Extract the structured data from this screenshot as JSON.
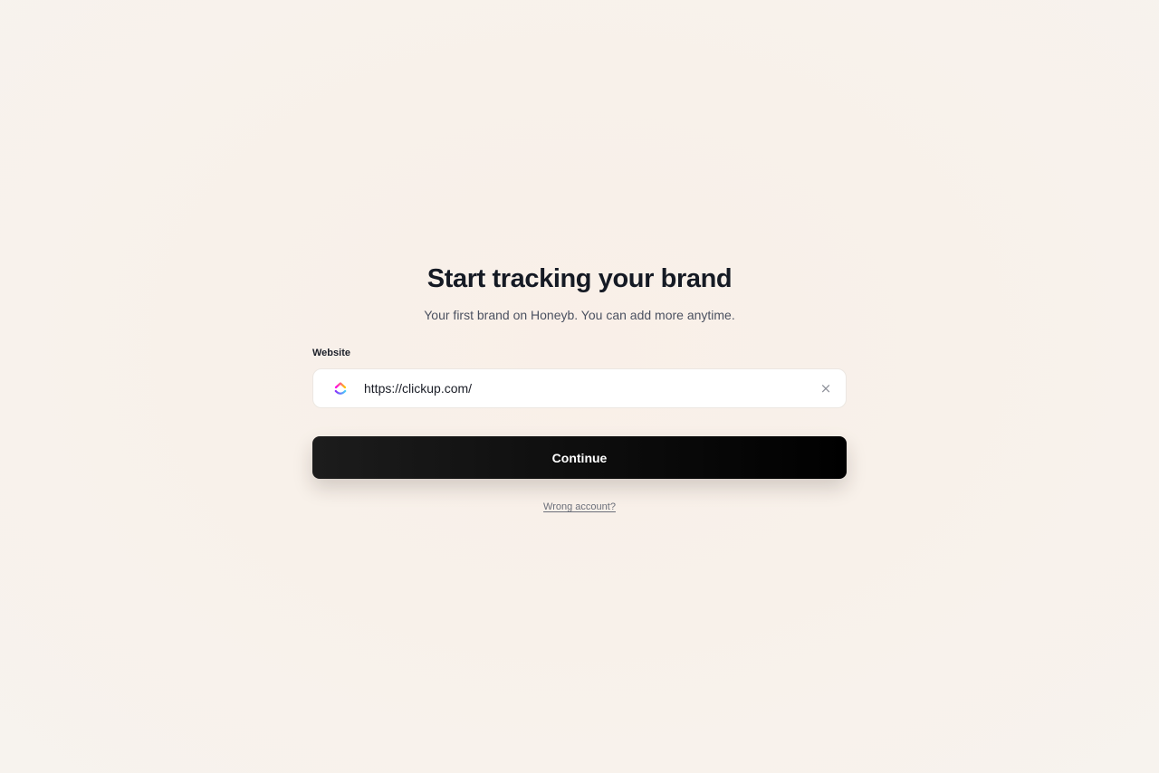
{
  "heading": {
    "title": "Start tracking your brand",
    "subtitle": "Your first brand on Honeyb. You can add more anytime."
  },
  "form": {
    "website_label": "Website",
    "website_value": "https://clickup.com/",
    "brand_icon": "clickup-logo-icon",
    "clear_icon": "close-icon",
    "clear_glyph": "×",
    "continue_label": "Continue",
    "wrong_account_link": "Wrong account?"
  },
  "colors": {
    "button_bg": "#000000",
    "button_text": "#ffffff",
    "background": "#f8f1ea",
    "logo_purple": "#7b68ee",
    "logo_pink": "#fd71af",
    "logo_orange": "#ffc800"
  }
}
